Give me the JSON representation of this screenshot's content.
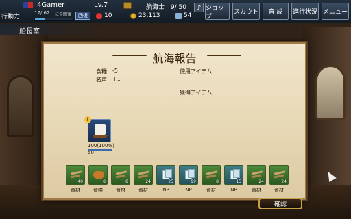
{
  "header": {
    "player_name": "4Gamer",
    "level": "Lv.7",
    "crew_label": "航海士",
    "crew_count": "9/ 50",
    "action_label": "行動力",
    "action_value": "17/ 62",
    "action_note": "に全回復",
    "action_fraction": 0.27,
    "recover_label": "回復",
    "hearts": "10",
    "coins": "23,113",
    "ships": "54"
  },
  "menu": {
    "shop": "ショップ",
    "scout": "スカウト",
    "train": "育 成",
    "progress": "進行状況",
    "menu": "メニュー"
  },
  "room": {
    "title": "船長室"
  },
  "report": {
    "title": "航海報告",
    "food_label": "食糧",
    "food_value": "-5",
    "fame_label": "名声",
    "fame_value": "+1",
    "used_items_label": "使用アイテム",
    "gained_items_label": "獲得アイテム",
    "ship": {
      "value_1": "100(100%)",
      "value_2": "50",
      "badge": "i"
    },
    "items": [
      {
        "icon": "lumber-icon",
        "qty": "40",
        "label": "資材"
      },
      {
        "icon": "bread-icon",
        "qty": "8",
        "label": "食糧"
      },
      {
        "icon": "lumber-icon",
        "qty": "8",
        "label": "資材"
      },
      {
        "icon": "lumber-icon",
        "qty": "24",
        "label": "資材"
      },
      {
        "icon": "np-card-icon",
        "qty": "25",
        "label": "NP"
      },
      {
        "icon": "np-card-icon",
        "qty": "99",
        "label": "NP"
      },
      {
        "icon": "lumber-icon",
        "qty": "8",
        "label": "資材"
      },
      {
        "icon": "np-card-icon",
        "qty": "15",
        "label": "NP"
      },
      {
        "icon": "lumber-icon",
        "qty": "24",
        "label": "資材"
      },
      {
        "icon": "lumber-icon",
        "qty": "24",
        "label": "資材"
      }
    ],
    "confirm_label": "確認"
  }
}
